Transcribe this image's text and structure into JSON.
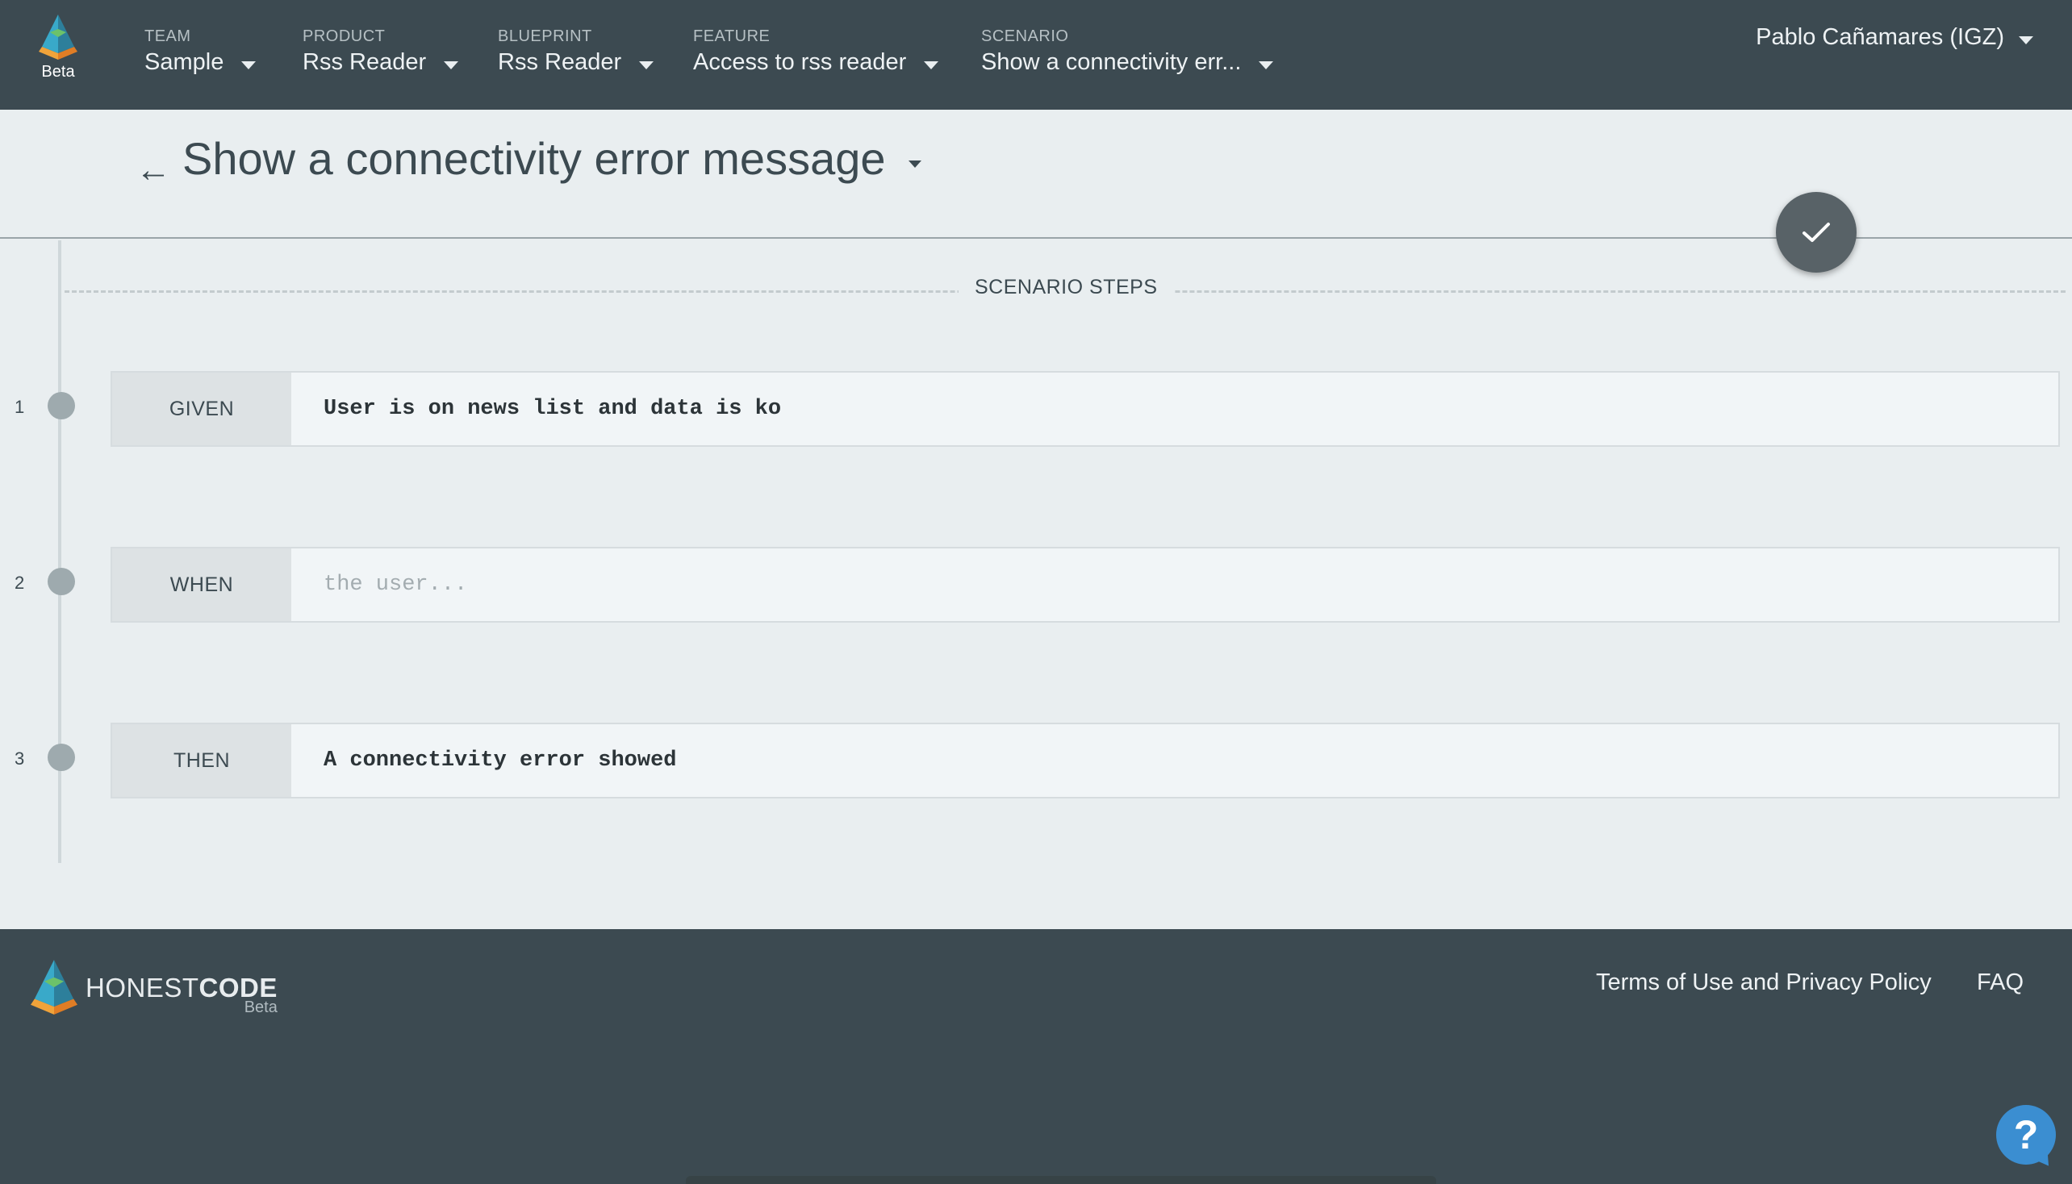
{
  "app": {
    "beta_label": "Beta"
  },
  "nav": [
    {
      "category": "TEAM",
      "value": "Sample"
    },
    {
      "category": "PRODUCT",
      "value": "Rss Reader"
    },
    {
      "category": "BLUEPRINT",
      "value": "Rss Reader"
    },
    {
      "category": "FEATURE",
      "value": "Access to rss reader"
    },
    {
      "category": "SCENARIO",
      "value": "Show a connectivity err..."
    }
  ],
  "user": {
    "name": "Pablo Cañamares (IGZ)"
  },
  "page": {
    "back_icon": "←",
    "title": "Show a connectivity error message",
    "section_label": "SCENARIO STEPS",
    "confirm_icon": "check-icon"
  },
  "steps": [
    {
      "number": "1",
      "keyword": "GIVEN",
      "text": "User is on news list and data is ko",
      "placeholder": ""
    },
    {
      "number": "2",
      "keyword": "WHEN",
      "text": "",
      "placeholder": "the user..."
    },
    {
      "number": "3",
      "keyword": "THEN",
      "text": "A connectivity error showed",
      "placeholder": ""
    }
  ],
  "footer": {
    "brand_light": "HONEST",
    "brand_bold": "CODE",
    "brand_beta": "Beta",
    "terms_link": "Terms of Use and Privacy Policy",
    "faq_link": "FAQ",
    "help_icon": "?"
  },
  "colors": {
    "header_bg": "#3c4a51",
    "content_bg": "#e9eef0",
    "help_blue": "#3b8ed1"
  }
}
